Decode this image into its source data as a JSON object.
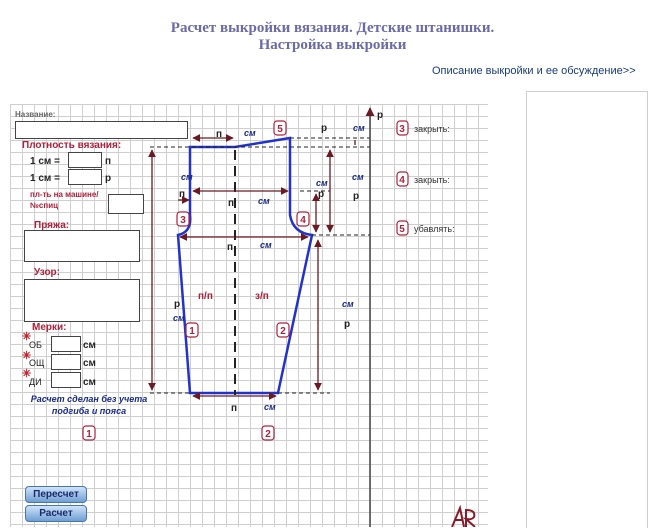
{
  "header": {
    "title_line1": "Расчет выкройки вязания. Детские штанишки.",
    "title_line2": "Настройка выкройки",
    "description_link": "Описание выкройки и ее обсуждение>>"
  },
  "form": {
    "name_label": "Название:",
    "name_value": "",
    "density_title": "Плотность вязания:",
    "density_row1_prefix": "1 см =",
    "density_row1_unit": "п",
    "density_row2_prefix": "1 см =",
    "density_row2_unit": "р",
    "machine_label_line1": "пл-ть на машине/",
    "machine_label_line2": "№спиц",
    "yarn_label": "Пряжа:",
    "pattern_label": "Узор:",
    "measures_label": "Мерки:",
    "measures": [
      {
        "code": "ОБ",
        "unit": "см"
      },
      {
        "code": "ОЩ",
        "unit": "см"
      },
      {
        "code": "ДИ",
        "unit": "см"
      }
    ],
    "note_line1": "Расчет сделан без учета",
    "note_line2": "подгиба и пояса",
    "left_badge_1": "1",
    "left_badge_2": "2",
    "recalc_button": "Пересчет",
    "calc_button": "Расчет"
  },
  "diagram": {
    "unit_p": "п",
    "unit_r": "р",
    "unit_cm": "см",
    "label_pp": "п/п",
    "label_zp": "з/п",
    "badges": [
      "1",
      "2",
      "3",
      "4",
      "5"
    ]
  },
  "instructions": [
    {
      "badge": "3",
      "text": "закрыть:"
    },
    {
      "badge": "4",
      "text": "закрыть:"
    },
    {
      "badge": "5",
      "text": "убавлять:"
    }
  ],
  "colors": {
    "title": "#6a6aa8",
    "accent_red": "#b0203a",
    "pattern_line": "#2233cc",
    "arrow": "#6a1a22"
  }
}
